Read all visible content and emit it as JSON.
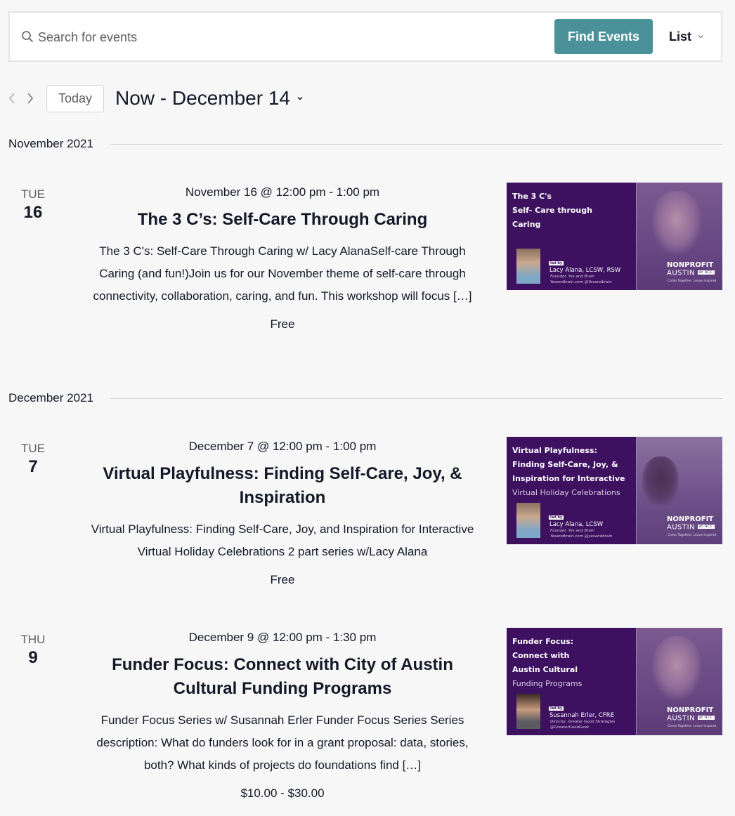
{
  "search": {
    "placeholder": "Search for events",
    "icon": "search-icon",
    "find_button_label": "Find Events",
    "view_label": "List",
    "accent_color": "#4a9199"
  },
  "nav": {
    "prev_icon": "chevron-left-icon",
    "next_icon": "chevron-right-icon",
    "today_label": "Today",
    "date_range_label": "Now - December 14"
  },
  "months": [
    {
      "label": "November 2021"
    },
    {
      "label": "December 2021"
    }
  ],
  "events": [
    {
      "dow": "TUE",
      "day": "16",
      "time": "November 16 @ 12:00 pm - 1:00 pm",
      "title": "The 3 C’s: Self-Care Through Caring",
      "description": "The 3 C's: Self-Care Through Caring w/ Lacy AlanaSelf-care Through Caring (and fun!)Join us for our November theme of self-care through connectivity, collaboration, caring, and fun. This workshop will focus […]",
      "cost": "Free",
      "image": {
        "heading_lines": [
          "The 3 C's",
          "Self- Care through",
          "Caring"
        ],
        "light_line": "",
        "led_by": "led by",
        "presenter": "Lacy Alana, LCSW, RSW",
        "role": "Founder, Yes and Brain",
        "web": "Yesandbrain.com @Yesandbrain",
        "logo_top": "NONPROFIT",
        "logo_bottom": "AUSTIN",
        "logo_badge": "at ACC",
        "tagline": "Come Together. Leave Inspired."
      }
    },
    {
      "dow": "TUE",
      "day": "7",
      "time": "December 7 @ 12:00 pm - 1:00 pm",
      "title": "Virtual Playfulness: Finding Self-Care, Joy, & Inspiration",
      "description": "Virtual Playfulness: Finding Self-Care, Joy, and Inspiration for Interactive Virtual Holiday Celebrations 2 part series w/Lacy Alana",
      "cost": "Free",
      "image": {
        "heading_lines": [
          "Virtual Playfulness:",
          "Finding Self-Care, Joy, &",
          "Inspiration for Interactive"
        ],
        "light_line": "Virtual Holiday Celebrations",
        "led_by": "led by",
        "presenter": "Lacy Alana, LCSW",
        "role": "Founder, Yes and Brain",
        "web": "Yesandbrain.com @yesandbrain",
        "logo_top": "NONPROFIT",
        "logo_bottom": "AUSTIN",
        "logo_badge": "at ACC",
        "tagline": "Come Together. Leave Inspired."
      }
    },
    {
      "dow": "THU",
      "day": "9",
      "time": "December 9 @ 12:00 pm - 1:30 pm",
      "title": "Funder Focus: Connect with City of Austin Cultural Funding Programs",
      "description": "Funder Focus Series w/ Susannah Erler Funder Focus Series Series description: What do funders look for in a grant proposal: data, stories, both? What kinds of projects do foundations find […]",
      "cost": "$10.00 - $30.00",
      "image": {
        "heading_lines": [
          "Funder Focus:",
          "Connect with",
          "Austin Cultural"
        ],
        "light_line": "Funding Programs",
        "led_by": "led by",
        "presenter": "Susannah Erler, CFRE",
        "role": "Director, Greater Good Strategies",
        "web": "@GreaterGoodGeek",
        "logo_top": "NONPROFIT",
        "logo_bottom": "AUSTIN",
        "logo_badge": "at ACC",
        "tagline": "Come Together. Leave Inspired."
      }
    }
  ]
}
